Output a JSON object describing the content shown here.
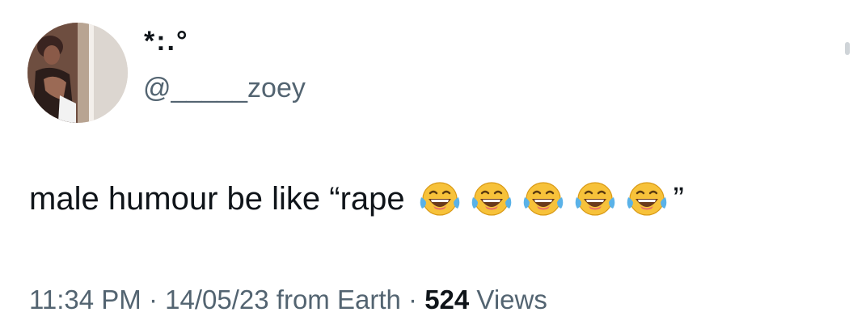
{
  "author": {
    "display_name": "*:.°",
    "handle": "@_____zoey",
    "avatar_icon": "profile-photo"
  },
  "tweet": {
    "text": "male humour be like “rape",
    "emoji_name": "face-with-tears-of-joy-icon",
    "emoji_count": 5,
    "closing_quote": "”"
  },
  "meta": {
    "time": "11:34 PM",
    "separator": "·",
    "date": "14/05/23",
    "location": "from Earth",
    "views_count": "524",
    "views_label": "Views"
  },
  "colors": {
    "text_primary": "#0f1419",
    "text_secondary": "#536471",
    "emoji_face": "#f7c23a",
    "emoji_tears": "#5ab2e8"
  }
}
